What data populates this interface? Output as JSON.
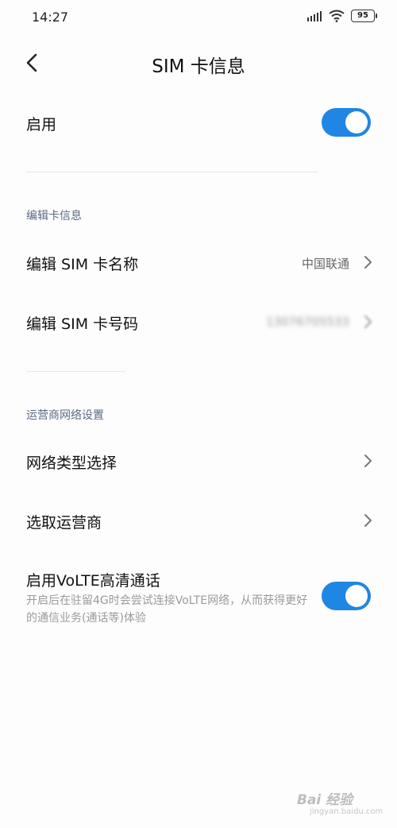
{
  "status_bar": {
    "time": "14:27",
    "battery": "95"
  },
  "header": {
    "title": "SIM 卡信息"
  },
  "enable_row": {
    "label": "启用",
    "enabled": true
  },
  "edit_section": {
    "title": "编辑卡信息",
    "items": [
      {
        "label": "编辑 SIM 卡名称",
        "value": "中国联通"
      },
      {
        "label": "编辑 SIM 卡号码",
        "value": "13076705533"
      }
    ]
  },
  "carrier_section": {
    "title": "运营商网络设置",
    "items": [
      {
        "label": "网络类型选择"
      },
      {
        "label": "选取运营商"
      }
    ]
  },
  "volte": {
    "label": "启用VoLTE高清通话",
    "description": "开启后在驻留4G时会尝试连接VoLTE网络，从而获得更好的通信业务(通话等)体验",
    "enabled": true
  },
  "watermark": {
    "text": "Bai 经验",
    "sub": "jingyan.baidu.com"
  },
  "colors": {
    "accent": "#1f86e3",
    "section_title": "#5a6b84"
  }
}
